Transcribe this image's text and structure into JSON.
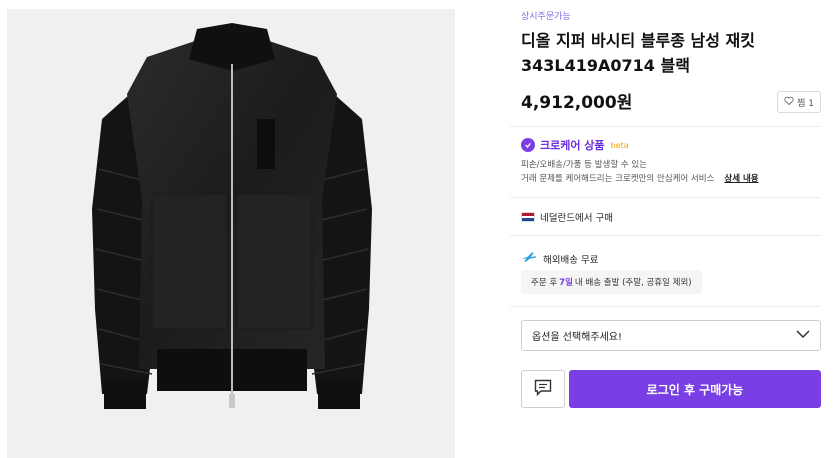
{
  "product": {
    "tag": "상시주문가능",
    "title": "디올 지퍼 바시티 블루종 남성 재킷 343L419A0714 블랙",
    "price": "4,912,000원",
    "like_label": "찜 1",
    "image_alt": "black suede bomber jacket"
  },
  "care": {
    "title": "크로케어 상품",
    "beta": "beta",
    "desc1": "피손/오배송/가품 등 발생할 수 있는",
    "desc2": "거래 문제를 케어해드리는 크로켓만의 안심케어 서비스",
    "link": "상세 내용"
  },
  "origin": {
    "country": "네덜란드",
    "suffix": "에서 구매",
    "flag_colors": [
      "#ae1c28",
      "#ffffff",
      "#21468b"
    ]
  },
  "shipping": {
    "label": "해외배송 무료",
    "note_prefix": "주문 후",
    "note_days": "7일",
    "note_suffix": "내 배송 출발 (주말, 공휴일 제외)"
  },
  "option": {
    "placeholder": "옵션을 선택해주세요!"
  },
  "buttons": {
    "buy_label": "로그인 후 구매가능"
  },
  "colors": {
    "accent": "#7a3fe4",
    "beta": "#f3a712"
  }
}
